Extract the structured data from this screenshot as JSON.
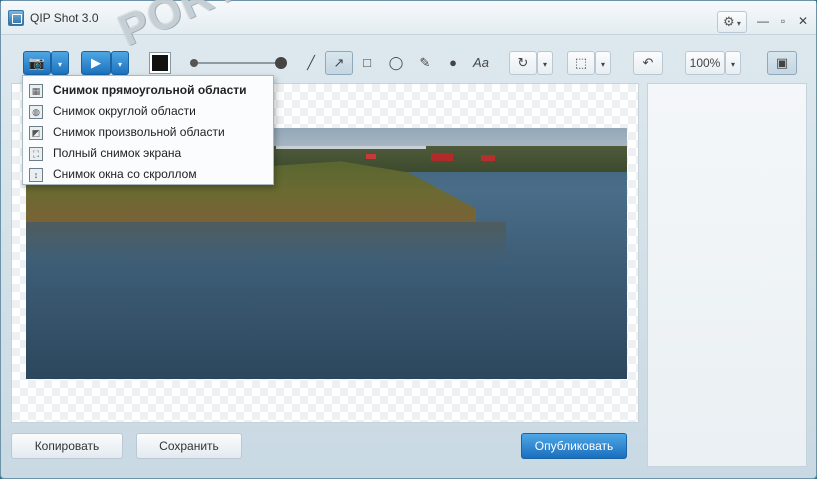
{
  "window": {
    "title": "QIP Shot 3.0"
  },
  "watermark": "PORTAL",
  "toolbar": {
    "zoom_value": "100%"
  },
  "icons": {
    "app": "app-icon",
    "settings": "gear-icon",
    "minimize": "minimize-icon",
    "maximize": "maximize-icon",
    "close": "close-icon",
    "camera": "camera-icon",
    "video": "video-camera-icon",
    "line": "line-icon",
    "arrow": "arrow-icon",
    "rectangle": "rectangle-icon",
    "ellipse": "ellipse-icon",
    "pencil": "pencil-icon",
    "blur": "drop-icon",
    "text": "text-icon",
    "rotate": "rotate-icon",
    "selection": "selection-icon",
    "undo": "undo-icon",
    "calendar": "calendar-icon"
  },
  "capture_menu": {
    "items": [
      {
        "label": "Снимок прямоугольной области",
        "selected": true
      },
      {
        "label": "Снимок округлой области",
        "selected": false
      },
      {
        "label": "Снимок произвольной области",
        "selected": false
      },
      {
        "label": "Полный снимок экрана",
        "selected": false
      },
      {
        "label": "Снимок окна со скроллом",
        "selected": false
      }
    ]
  },
  "bottom": {
    "copy_label": "Копировать",
    "save_label": "Сохранить",
    "publish_label": "Опубликовать"
  },
  "colors": {
    "accent": "#1c72bd",
    "stroke_color": "#111111"
  }
}
